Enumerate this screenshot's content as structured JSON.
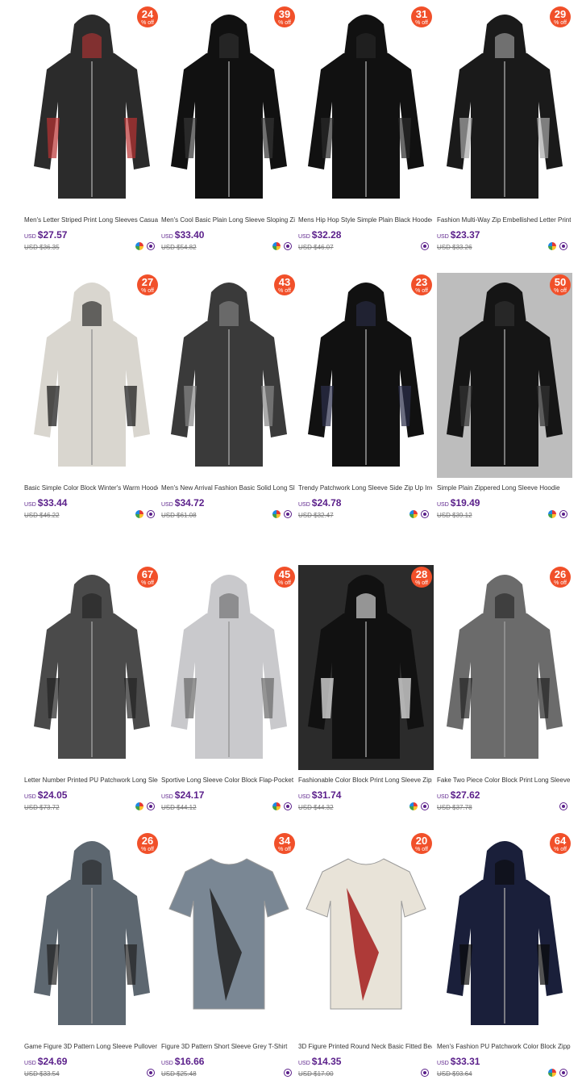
{
  "colors": {
    "badge": "#f1502a",
    "price": "#5a1f8a"
  },
  "labels": {
    "currency": "USD",
    "off": "% off"
  },
  "products": [
    {
      "title": "Men's Letter Striped Print Long Sleeves Casual",
      "price": "$27.57",
      "orig": "USD $36.35",
      "discount": "24",
      "icons": [
        "color-swatch-icon",
        "favorite-heart-icon"
      ]
    },
    {
      "title": "Men's Cool Basic Plain Long Sleeve Sloping Zip",
      "price": "$33.40",
      "orig": "USD $54.82",
      "discount": "39",
      "icons": [
        "color-swatch-icon",
        "favorite-heart-icon"
      ]
    },
    {
      "title": "Mens Hip Hop Style Simple Plain Black Hoodec",
      "price": "$32.28",
      "orig": "USD $46.07",
      "discount": "31",
      "icons": [
        "favorite-heart-icon"
      ]
    },
    {
      "title": "Fashion Multi-Way Zip Embellished Letter Print",
      "price": "$23.37",
      "orig": "USD $33.26",
      "discount": "29",
      "icons": [
        "color-swatch-icon",
        "favorite-heart-icon"
      ]
    },
    {
      "title": "Basic Simple Color Block Winter's Warm Hoode",
      "price": "$33.44",
      "orig": "USD $46.22",
      "discount": "27",
      "icons": [
        "color-swatch-icon",
        "favorite-heart-icon"
      ]
    },
    {
      "title": "Men's New Arrival Fashion Basic Solid Long Sl",
      "price": "$34.72",
      "orig": "USD $61.08",
      "discount": "43",
      "icons": [
        "color-swatch-icon",
        "favorite-heart-icon"
      ]
    },
    {
      "title": "Trendy Patchwork Long Sleeve Side Zip Up Irre",
      "price": "$24.78",
      "orig": "USD $32.47",
      "discount": "23",
      "icons": [
        "color-swatch-icon",
        "favorite-heart-icon"
      ]
    },
    {
      "title": "Simple Plain Zippered Long Sleeve Hoodie",
      "price": "$19.49",
      "orig": "USD $39.12",
      "discount": "50",
      "icons": [
        "color-swatch-icon",
        "favorite-heart-icon"
      ]
    },
    {
      "title": "Letter Number Printed PU Patchwork Long Slee",
      "price": "$24.05",
      "orig": "USD $73.72",
      "discount": "67",
      "icons": [
        "color-swatch-icon",
        "favorite-heart-icon"
      ]
    },
    {
      "title": "Sportive Long Sleeve Color Block Flap-Pocket",
      "price": "$24.17",
      "orig": "USD $44.12",
      "discount": "45",
      "icons": [
        "color-swatch-icon",
        "favorite-heart-icon"
      ]
    },
    {
      "title": "Fashionable Color Block Print Long Sleeve Zipp",
      "price": "$31.74",
      "orig": "USD $44.32",
      "discount": "28",
      "icons": [
        "color-swatch-icon",
        "favorite-heart-icon"
      ]
    },
    {
      "title": "Fake Two Piece Color Block Print Long Sleeve",
      "price": "$27.62",
      "orig": "USD $37.78",
      "discount": "26",
      "icons": [
        "favorite-heart-icon"
      ]
    },
    {
      "title": "Game Figure 3D Pattern Long Sleeve Pullover",
      "price": "$24.69",
      "orig": "USD $33.54",
      "discount": "26",
      "icons": [
        "favorite-heart-icon"
      ]
    },
    {
      "title": "Figure 3D Pattern Short Sleeve Grey T-Shirt",
      "price": "$16.66",
      "orig": "USD $25.48",
      "discount": "34",
      "icons": [
        "favorite-heart-icon"
      ]
    },
    {
      "title": "3D Figure Printed Round Neck Basic Fitted Bea",
      "price": "$14.35",
      "orig": "USD $17.00",
      "discount": "20",
      "icons": [
        "favorite-heart-icon"
      ]
    },
    {
      "title": "Men's Fashion PU Patchwork Color Block Zippe",
      "price": "$33.31",
      "orig": "USD $93.64",
      "discount": "64",
      "icons": [
        "color-swatch-icon",
        "favorite-heart-icon"
      ]
    }
  ]
}
